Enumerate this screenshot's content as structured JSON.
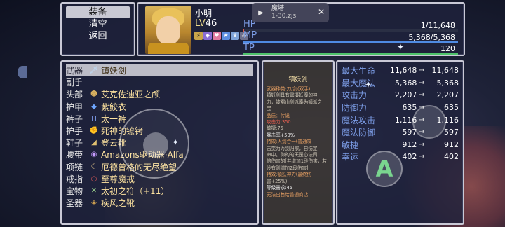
{
  "menu": {
    "items": [
      "装备",
      "清空",
      "返回"
    ],
    "selected_index": 0
  },
  "hero": {
    "name": "小明",
    "level_label": "LV",
    "level": "46",
    "hp_label": "HP",
    "hp_value": "1/11,648",
    "mp_label": "MP",
    "mp_value": "5,368/5,368",
    "tp_label": "TP",
    "tp_value": "120",
    "hp_fraction": 0.0001,
    "mp_fraction": 1.0,
    "tp_fraction": 1.0,
    "hp_color": "#e05a4e",
    "mp_color": "#4f8be3",
    "tp_color": "#4fc46b",
    "status_icons": [
      "lightning-icon",
      "shield-icon",
      "heart-icon",
      "star-icon",
      "crown-icon",
      "skull-icon"
    ]
  },
  "tab": {
    "title": "魔塔",
    "subtitle": "1-30.zjs",
    "play_glyph": "▶",
    "close_glyph": "✕"
  },
  "equipment": [
    {
      "slot": "武器",
      "name": "镇妖剑",
      "icon": "sword-icon",
      "glyph": "🗡"
    },
    {
      "slot": "副手",
      "name": "",
      "icon": "",
      "glyph": ""
    },
    {
      "slot": "头部",
      "name": "艾克佐迪亚之颅",
      "icon": "skull-icon",
      "glyph": "☻"
    },
    {
      "slot": "护甲",
      "name": "紫鲛衣",
      "icon": "armor-icon",
      "glyph": "◆"
    },
    {
      "slot": "裤子",
      "name": "太一裤",
      "icon": "pants-icon",
      "glyph": "Π"
    },
    {
      "slot": "护手",
      "name": "死神的镣铐",
      "icon": "gauntlet-icon",
      "glyph": "✊"
    },
    {
      "slot": "鞋子",
      "name": "登云靴",
      "icon": "boot-icon",
      "glyph": "◢"
    },
    {
      "slot": "腰带",
      "name": "Amazons驱动器·Alfa",
      "icon": "belt-icon",
      "glyph": "◉"
    },
    {
      "slot": "项链",
      "name": "厄德曾格的无尽绝望",
      "icon": "necklace-icon",
      "glyph": "☾"
    },
    {
      "slot": "戒指",
      "name": "至尊魔戒",
      "icon": "ring-icon",
      "glyph": "○"
    },
    {
      "slot": "宝物",
      "name": "太初之符（+11）",
      "icon": "talisman-icon",
      "glyph": "✕"
    },
    {
      "slot": "圣器",
      "name": "疾风之靴",
      "icon": "relic-icon",
      "glyph": "◈"
    }
  ],
  "detail": {
    "title": "镇妖剑",
    "lines": [
      {
        "text": "武器种类:刀/剑(双手)",
        "tone": "orange"
      },
      {
        "text": "镇妖剑具有震摄妖魔的神",
        "tone": "normal"
      },
      {
        "text": "力，被蜀山剑派奉为镇派之",
        "tone": "normal"
      },
      {
        "text": "宝",
        "tone": "normal"
      },
      {
        "text": "品质：传说",
        "tone": "orange"
      },
      {
        "text": "攻击力:350",
        "tone": "red"
      },
      {
        "text": "敏捷:75",
        "tone": "normal"
      },
      {
        "text": "暴击率+50%",
        "tone": "white"
      },
      {
        "text": "特效:人剑合一(普通攻",
        "tone": "orange"
      },
      {
        "text": "击变为万剑归宗，自伤定",
        "tone": "normal"
      },
      {
        "text": "命中。你的的天罡心法四",
        "tone": "normal"
      },
      {
        "text": "倍伤害的[并增加1段伤害，若",
        "tone": "normal"
      },
      {
        "text": "没有则增加2段伤害]",
        "tone": "normal"
      },
      {
        "text": "特效:镇妖神力(最终伤",
        "tone": "orange"
      },
      {
        "text": "害+25%)",
        "tone": "normal"
      },
      {
        "text": "等级需求:45",
        "tone": "white"
      },
      {
        "text": "无法出售给普通商店",
        "tone": "orange"
      }
    ]
  },
  "compare": [
    {
      "label": "最大生命",
      "current": "11,648",
      "arrow": "→",
      "new": "11,648"
    },
    {
      "label": "最大魔法",
      "current": "5,368",
      "arrow": "→",
      "new": "5,368"
    },
    {
      "label": "攻击力",
      "current": "2,207",
      "arrow": "→",
      "new": "2,207"
    },
    {
      "label": "防御力",
      "current": "635",
      "arrow": "→",
      "new": "635"
    },
    {
      "label": "魔法攻击",
      "current": "1,116",
      "arrow": "→",
      "new": "1,116"
    },
    {
      "label": "魔法防御",
      "current": "597",
      "arrow": "→",
      "new": "597"
    },
    {
      "label": "敏捷",
      "current": "912",
      "arrow": "→",
      "new": "912"
    },
    {
      "label": "幸运",
      "current": "402",
      "arrow": "→",
      "new": "402"
    }
  ],
  "controls": {
    "a_label": "A"
  }
}
